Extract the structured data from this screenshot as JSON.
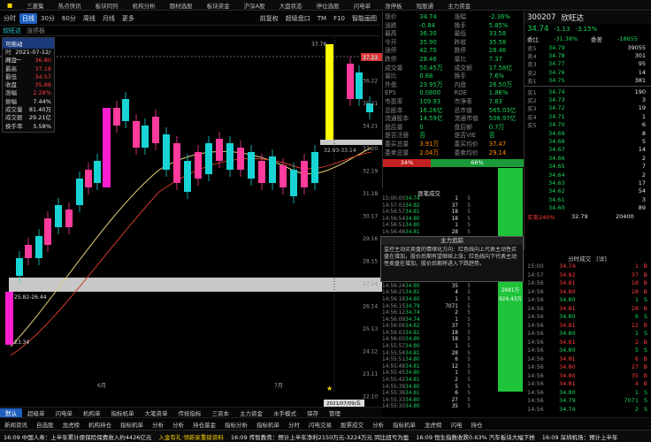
{
  "topbar": [
    "三菱集",
    "热点快讯",
    "板块同列",
    "机构分析",
    "题材选股",
    "板块资金",
    "沪深A股",
    "大盘状态",
    "停位选股",
    "闪电单",
    "涨停板",
    "短股通",
    "主力资金",
    "题材分析"
  ],
  "toolbar": {
    "items": [
      "分时",
      "日线",
      "30分",
      "60分",
      "周线",
      "月线",
      "更多"
    ],
    "selected": "日线",
    "right": [
      "前复权",
      "超级盘口",
      "TM",
      "F10",
      "智能画图"
    ]
  },
  "stock_name": "欣旺达",
  "indicator_label": "连续复合",
  "price_label": "涨停板",
  "tooltip": {
    "title": "可拖动",
    "rows": [
      [
        "时间",
        "2021-07-12/一"
      ],
      [
        "开盘",
        "36.80"
      ],
      [
        "最高",
        "37.18"
      ],
      [
        "最低",
        "34.57"
      ],
      [
        "收盘",
        "35.88"
      ],
      [
        "涨幅",
        "2.28%"
      ],
      [
        "振幅",
        "7.44%"
      ],
      [
        "成交量",
        "81.40万"
      ],
      [
        "成交额",
        "29.21亿"
      ],
      [
        "换手率",
        "5.58%"
      ]
    ]
  },
  "price_axis": [
    "37.23",
    "36.22",
    "35.21",
    "34.21",
    "33.20",
    "32.19",
    "31.18",
    "30.17",
    "29.16",
    "28.15",
    "27.14",
    "26.14",
    "25.13",
    "24.12",
    "23.11",
    "22.10"
  ],
  "chart_labels": {
    "high": "37.78",
    "zone": "32.93-33.14",
    "low_zone": "25.82-26.44",
    "low": "23.34",
    "date": "2021/07/09/五",
    "month_jun": "6月",
    "month_jul": "7月"
  },
  "indicator_tabs": [
    "默认",
    "超级单",
    "闪电单",
    "机构单",
    "指标机单",
    "大笔资单",
    "传统指标",
    "三资本",
    "主力资金",
    "水手模式",
    "保存",
    "管理"
  ],
  "bottom_tabs": [
    "新闻资讯",
    "自选股",
    "龙虎榜",
    "机构持仓",
    "指标机单",
    "分析",
    "分析",
    "持仓基金",
    "指标分析",
    "指标机单",
    "分时",
    "闪电交易",
    "股票成交",
    "分析",
    "指标机单",
    "龙虎榜",
    "闪电",
    "持仓"
  ],
  "quote": {
    "code": "300207",
    "name": "欣旺达",
    "price": "34.74",
    "chg": "-1.13",
    "pct": "-3.15%",
    "rows": [
      [
        "现价",
        "34.74",
        "涨幅",
        "-2.36%"
      ],
      [
        "涨跌",
        "-0.84",
        "换手",
        "5.85%"
      ],
      [
        "最高",
        "36.30",
        "最低",
        "33.58"
      ],
      [
        "今开",
        "35.90",
        "昨收",
        "35.58"
      ],
      [
        "涨停",
        "42.70",
        "跌停",
        "28.46"
      ],
      [
        "跌停",
        "28.46",
        "量比",
        "7.37"
      ],
      [
        "成交量",
        "50.45万",
        "成交额",
        "17.58亿"
      ],
      [
        "量比",
        "0.68",
        "换手",
        "7.6%"
      ],
      [
        "外盘",
        "23.95万",
        "内盘",
        "26.50万"
      ],
      [
        "EPS",
        "0.0800",
        "ROE",
        "1.86%"
      ],
      [
        "市盈率",
        "109.93",
        "市净率",
        "7.83"
      ],
      [
        "总股本",
        "16.26亿",
        "总市值",
        "565.03亿"
      ],
      [
        "流通股本",
        "14.59亿",
        "流通市值",
        "506.97亿"
      ],
      [
        "盘后量",
        "0",
        "盘后额",
        "0.7万"
      ],
      [
        "是否注册",
        "否",
        "是否VIE",
        "否"
      ],
      [
        "委买总量",
        "3.91万",
        "委买均价",
        "37.47"
      ],
      [
        "委卖总量",
        "2.04万",
        "委卖均价",
        "29.14"
      ]
    ],
    "ratio": [
      "34%",
      "66%"
    ]
  },
  "orderbook": {
    "header": [
      "委比",
      "-31.38%",
      "委差",
      "-18655"
    ],
    "sells": [
      [
        "卖5",
        "34.79",
        "39055"
      ],
      [
        "卖4",
        "34.78",
        "301"
      ],
      [
        "卖3",
        "34.77",
        "95"
      ],
      [
        "卖2",
        "34.76",
        "14"
      ],
      [
        "卖1",
        "34.75",
        "381"
      ]
    ],
    "buys": [
      [
        "买1",
        "34.74",
        "190"
      ],
      [
        "买2",
        "34.73",
        "3"
      ],
      [
        "买3",
        "34.72",
        "19"
      ],
      [
        "买4",
        "34.71",
        "1"
      ],
      [
        "买5",
        "34.70",
        "6"
      ],
      [
        "",
        "34.69",
        "8"
      ],
      [
        "",
        "34.68",
        "5"
      ],
      [
        "",
        "34.67",
        "14"
      ],
      [
        "",
        "34.66",
        "2"
      ],
      [
        "",
        "34.65",
        "7"
      ],
      [
        "",
        "34.64",
        "2"
      ],
      [
        "",
        "34.63",
        "17"
      ],
      [
        "",
        "34.62",
        "54"
      ],
      [
        "",
        "34.61",
        "3"
      ],
      [
        "",
        "34.60",
        "89"
      ]
    ],
    "footer": [
      "买卖240%",
      "32.79",
      "20400"
    ]
  },
  "popup": {
    "title": "主力追踪",
    "text": "监控主动买卖盘的情绪化方向：红色线向上代表主动性买盘在增加，股价后期有望继续上涨；红色线向下代表主动性卖盘在增加，股价后期将进入下跌趋势。"
  },
  "tape_header": [
    "逐笔成交",
    "2681万",
    "924.43万"
  ],
  "ticks": [
    [
      "15:00",
      "34.74",
      "1",
      "B"
    ],
    [
      "14:57",
      "34.82",
      "37",
      "B"
    ],
    [
      "14:56",
      "34.81",
      "18",
      "B"
    ],
    [
      "14:56",
      "34.80",
      "18",
      "B"
    ],
    [
      "14:56",
      "34.80",
      "1",
      "S"
    ],
    [
      "14:56",
      "34.81",
      "28",
      "B"
    ],
    [
      "14:56",
      "34.80",
      "6",
      "S"
    ],
    [
      "14:56",
      "34.81",
      "12",
      "B"
    ],
    [
      "14:56",
      "34.80",
      "1",
      "S"
    ],
    [
      "14:56",
      "34.81",
      "2",
      "B"
    ],
    [
      "14:56",
      "34.80",
      "5",
      "S"
    ],
    [
      "14:56",
      "34.81",
      "6",
      "B"
    ],
    [
      "14:56",
      "34.80",
      "27",
      "B"
    ],
    [
      "14:56",
      "34.80",
      "35",
      "B"
    ],
    [
      "14:56",
      "34.81",
      "4",
      "B"
    ],
    [
      "14:56",
      "34.80",
      "1",
      "S"
    ],
    [
      "14:56",
      "34.79",
      "7071",
      "S"
    ],
    [
      "14:56",
      "34.74",
      "2",
      "S"
    ]
  ],
  "tick_tabs": [
    "分时成交",
    "[详]"
  ],
  "news": [
    "16:09 中国人寿：上半年累计原保险保费收入约4426亿元",
    "入金有礼·领新家重磅资料",
    "16:09 传智教育：预计上半年净利2150万元-3224万元 同比扭亏为盈",
    "16:09 恒生指数收跌0.63% 汽车板块大幅下挫",
    "16:09 深圳机场：预计上半年"
  ]
}
